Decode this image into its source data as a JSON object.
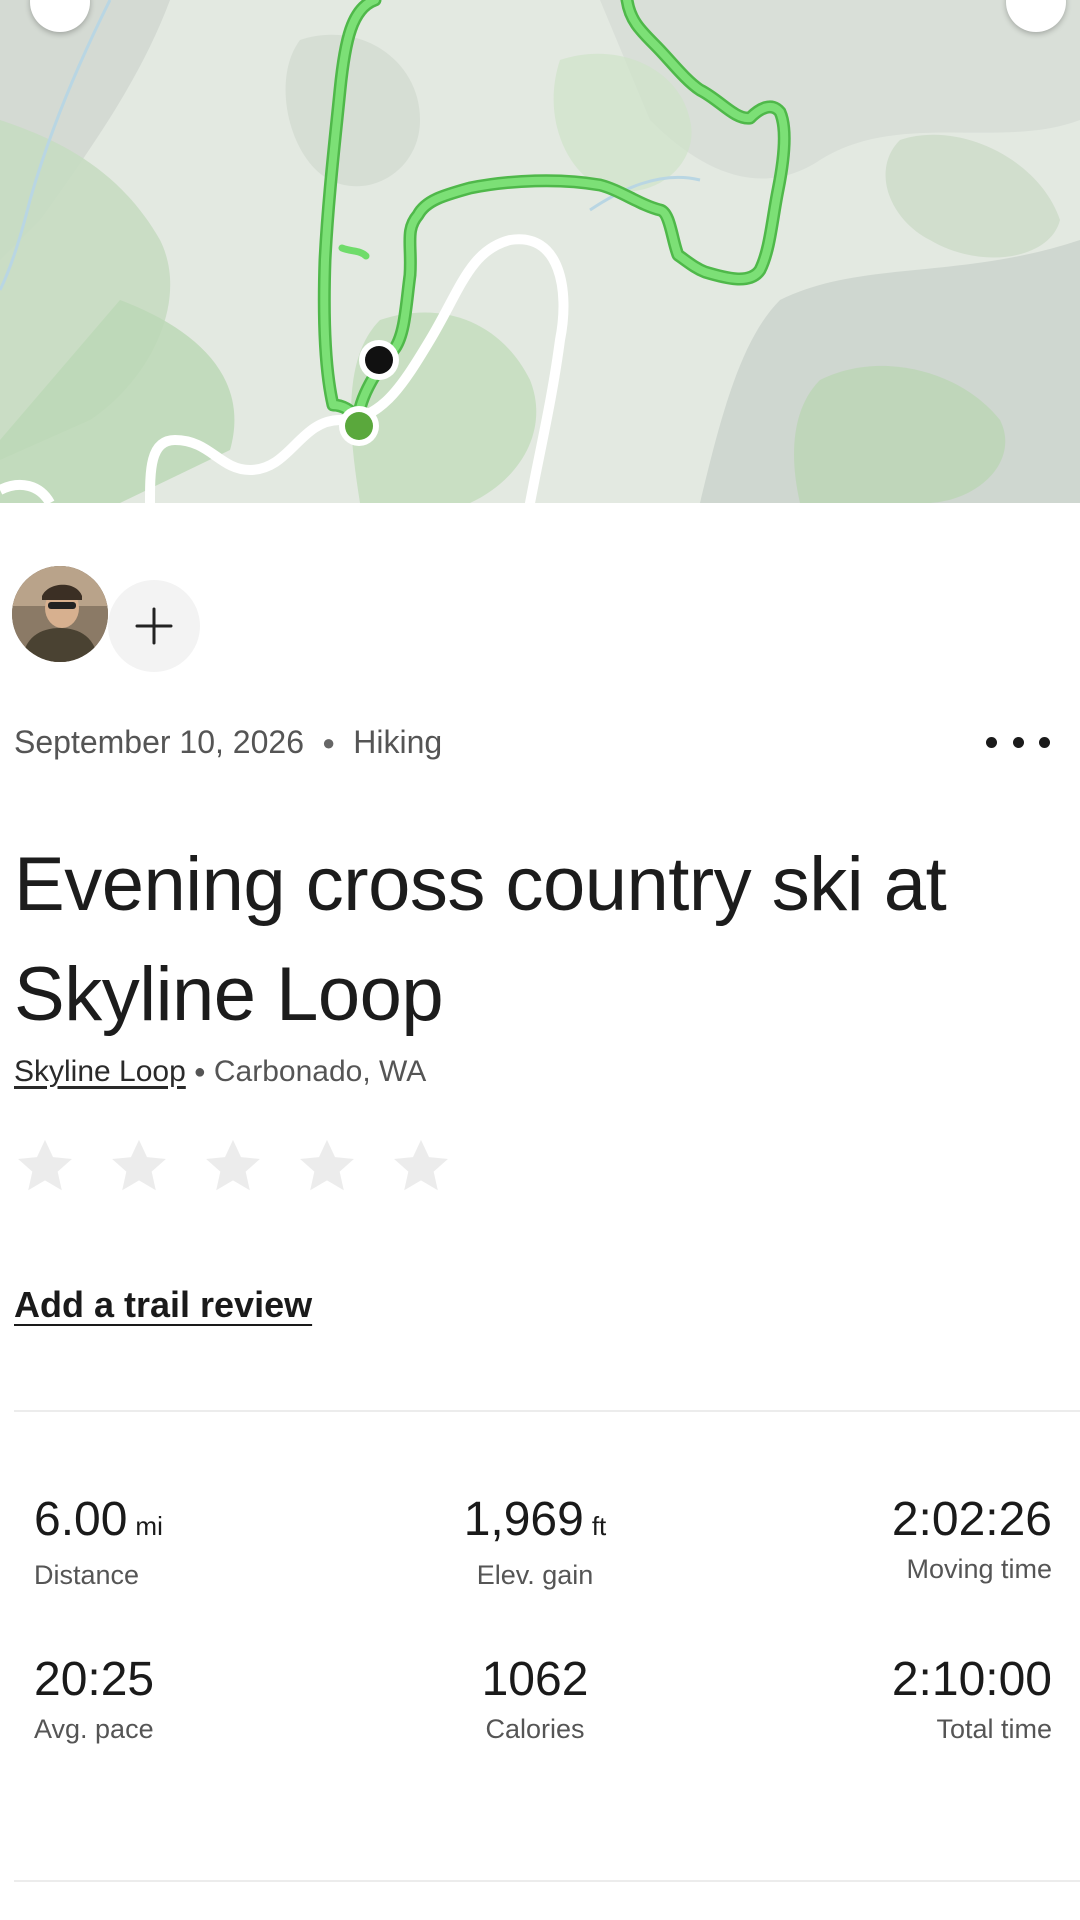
{
  "activity": {
    "date": "September 10, 2026",
    "type": "Hiking",
    "title": "Evening cross country ski at Skyline Loop",
    "trail_name": "Skyline Loop",
    "location": "Carbonado, WA"
  },
  "rating": {
    "stars": 0,
    "max": 5
  },
  "review_link": "Add a trail review",
  "stats": {
    "distance": {
      "value": "6.00",
      "unit": "mi",
      "label": "Distance"
    },
    "elevation": {
      "value": "1,969",
      "unit": "ft",
      "label": "Elev. gain"
    },
    "moving_time": {
      "value": "2:02:26",
      "label": "Moving time"
    },
    "avg_pace": {
      "value": "20:25",
      "label": "Avg. pace"
    },
    "calories": {
      "value": "1062",
      "label": "Calories"
    },
    "total_time": {
      "value": "2:10:00",
      "label": "Total time"
    }
  },
  "colors": {
    "route": "#6fdc6a",
    "route_start": "#5aa83c",
    "route_end": "#111111",
    "star_empty": "#ececec",
    "map_bg": "#e2e8e0"
  },
  "icons": {
    "more": "more-dots-icon",
    "add": "plus-icon",
    "star": "star-icon"
  }
}
